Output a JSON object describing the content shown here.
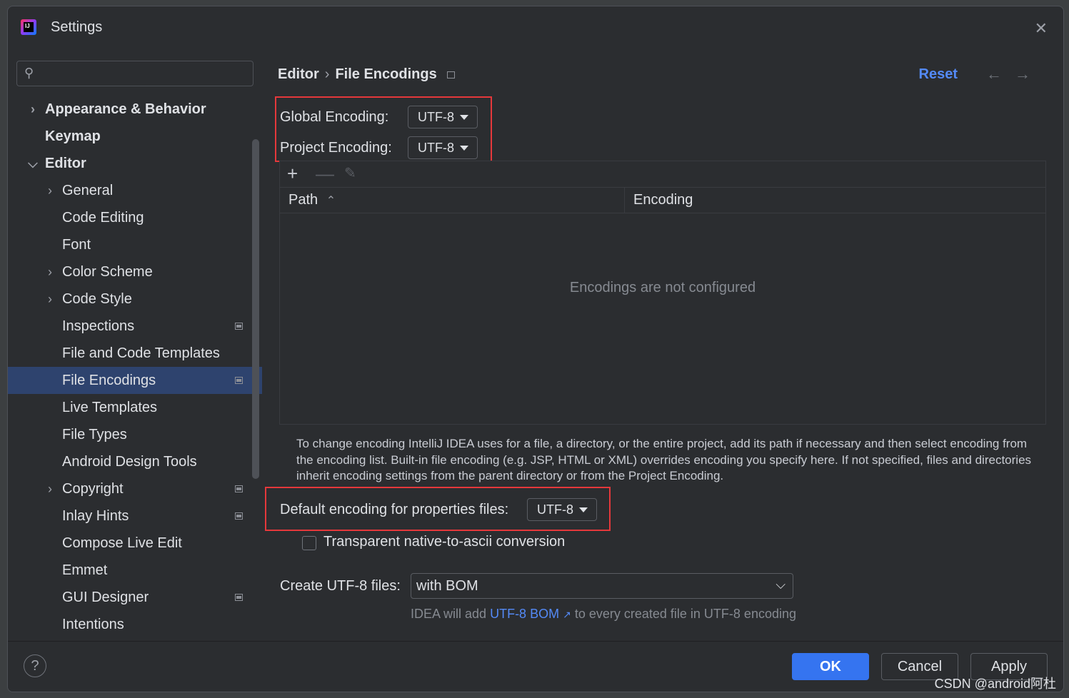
{
  "window": {
    "title": "Settings"
  },
  "search": {
    "placeholder": ""
  },
  "sidebar": {
    "items": [
      {
        "label": "Appearance & Behavior",
        "indent": 0,
        "chevron": "right",
        "bold": true,
        "badge": false,
        "selected": false
      },
      {
        "label": "Keymap",
        "indent": 0,
        "chevron": "none",
        "bold": true,
        "badge": false,
        "selected": false
      },
      {
        "label": "Editor",
        "indent": 0,
        "chevron": "down",
        "bold": true,
        "badge": false,
        "selected": false
      },
      {
        "label": "General",
        "indent": 1,
        "chevron": "right",
        "bold": false,
        "badge": false,
        "selected": false
      },
      {
        "label": "Code Editing",
        "indent": 1,
        "chevron": "none",
        "bold": false,
        "badge": false,
        "selected": false
      },
      {
        "label": "Font",
        "indent": 1,
        "chevron": "none",
        "bold": false,
        "badge": false,
        "selected": false
      },
      {
        "label": "Color Scheme",
        "indent": 1,
        "chevron": "right",
        "bold": false,
        "badge": false,
        "selected": false
      },
      {
        "label": "Code Style",
        "indent": 1,
        "chevron": "right",
        "bold": false,
        "badge": false,
        "selected": false
      },
      {
        "label": "Inspections",
        "indent": 1,
        "chevron": "none",
        "bold": false,
        "badge": true,
        "selected": false
      },
      {
        "label": "File and Code Templates",
        "indent": 1,
        "chevron": "none",
        "bold": false,
        "badge": false,
        "selected": false
      },
      {
        "label": "File Encodings",
        "indent": 1,
        "chevron": "none",
        "bold": false,
        "badge": true,
        "selected": true
      },
      {
        "label": "Live Templates",
        "indent": 1,
        "chevron": "none",
        "bold": false,
        "badge": false,
        "selected": false
      },
      {
        "label": "File Types",
        "indent": 1,
        "chevron": "none",
        "bold": false,
        "badge": false,
        "selected": false
      },
      {
        "label": "Android Design Tools",
        "indent": 1,
        "chevron": "none",
        "bold": false,
        "badge": false,
        "selected": false
      },
      {
        "label": "Copyright",
        "indent": 1,
        "chevron": "right",
        "bold": false,
        "badge": true,
        "selected": false
      },
      {
        "label": "Inlay Hints",
        "indent": 1,
        "chevron": "none",
        "bold": false,
        "badge": true,
        "selected": false
      },
      {
        "label": "Compose Live Edit",
        "indent": 1,
        "chevron": "none",
        "bold": false,
        "badge": false,
        "selected": false
      },
      {
        "label": "Emmet",
        "indent": 1,
        "chevron": "none",
        "bold": false,
        "badge": false,
        "selected": false
      },
      {
        "label": "GUI Designer",
        "indent": 1,
        "chevron": "none",
        "bold": false,
        "badge": true,
        "selected": false
      },
      {
        "label": "Intentions",
        "indent": 1,
        "chevron": "none",
        "bold": false,
        "badge": false,
        "selected": false
      }
    ]
  },
  "breadcrumb": {
    "parent": "Editor",
    "current": "File Encodings"
  },
  "header": {
    "reset_label": "Reset"
  },
  "encoding": {
    "global_label": "Global Encoding:",
    "global_value": "UTF-8",
    "project_label": "Project Encoding:",
    "project_value": "UTF-8"
  },
  "table": {
    "col_path": "Path",
    "col_encoding": "Encoding",
    "empty_text": "Encodings are not configured"
  },
  "help_text": "To change encoding IntelliJ IDEA uses for a file, a directory, or the entire project, add its path if necessary and then select encoding from the encoding list. Built-in file encoding (e.g. JSP, HTML or XML) overrides encoding you specify here. If not specified, files and directories inherit encoding settings from the parent directory or from the Project Encoding.",
  "properties": {
    "label": "Default encoding for properties files:",
    "value": "UTF-8",
    "checkbox_label": "Transparent native-to-ascii conversion",
    "checkbox_checked": false
  },
  "utf8": {
    "label": "Create UTF-8 files:",
    "value": "with BOM",
    "hint_prefix": "IDEA will add",
    "hint_link": "UTF-8 BOM",
    "hint_suffix": "to every created file in UTF-8 encoding"
  },
  "footer": {
    "ok_label": "OK",
    "cancel_label": "Cancel",
    "apply_label": "Apply",
    "help_label": "?"
  },
  "watermark": "CSDN @android阿杜",
  "colors": {
    "accent": "#3574f0",
    "link": "#548af7",
    "highlight_box": "#e5383b",
    "selection": "#2e436e"
  }
}
